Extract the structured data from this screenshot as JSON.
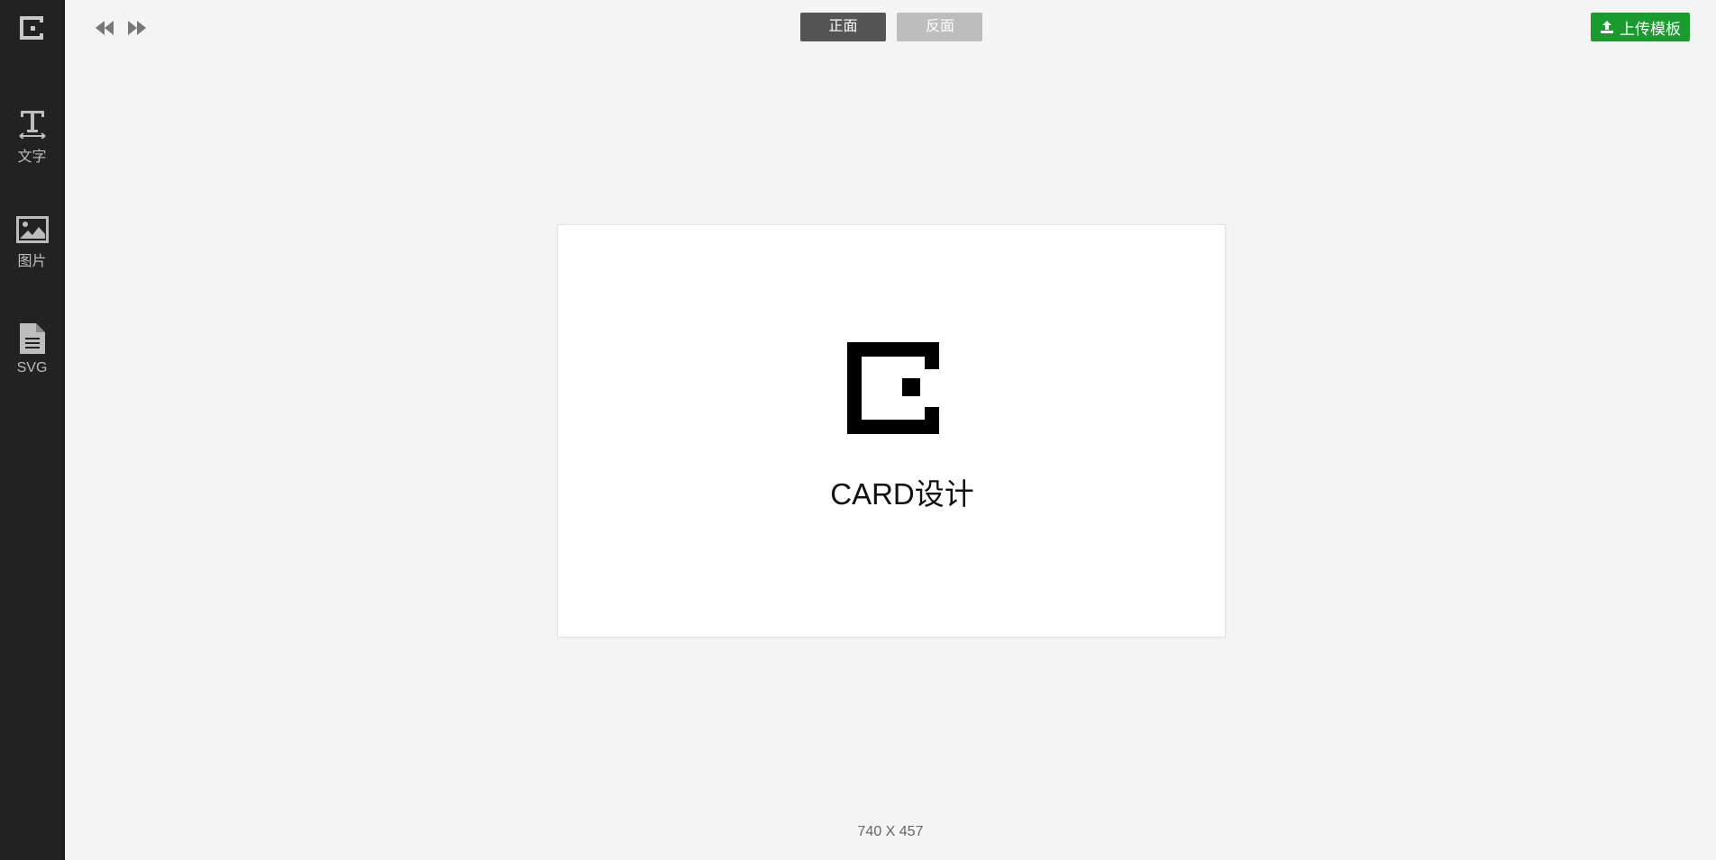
{
  "sidebar": {
    "logo_icon": "brand-logo-icon",
    "tools": [
      {
        "label": "文字",
        "icon": "text-icon"
      },
      {
        "label": "图片",
        "icon": "image-icon"
      },
      {
        "label": "SVG",
        "icon": "file-icon"
      }
    ]
  },
  "toolbar": {
    "undo_icon": "rewind-icon",
    "redo_icon": "fast-forward-icon",
    "front_label": "正面",
    "back_label": "反面",
    "upload_label": "上传模板",
    "upload_color": "#1a9b2e"
  },
  "canvas": {
    "title": "CARD设计",
    "dimensions": "740 X 457"
  }
}
